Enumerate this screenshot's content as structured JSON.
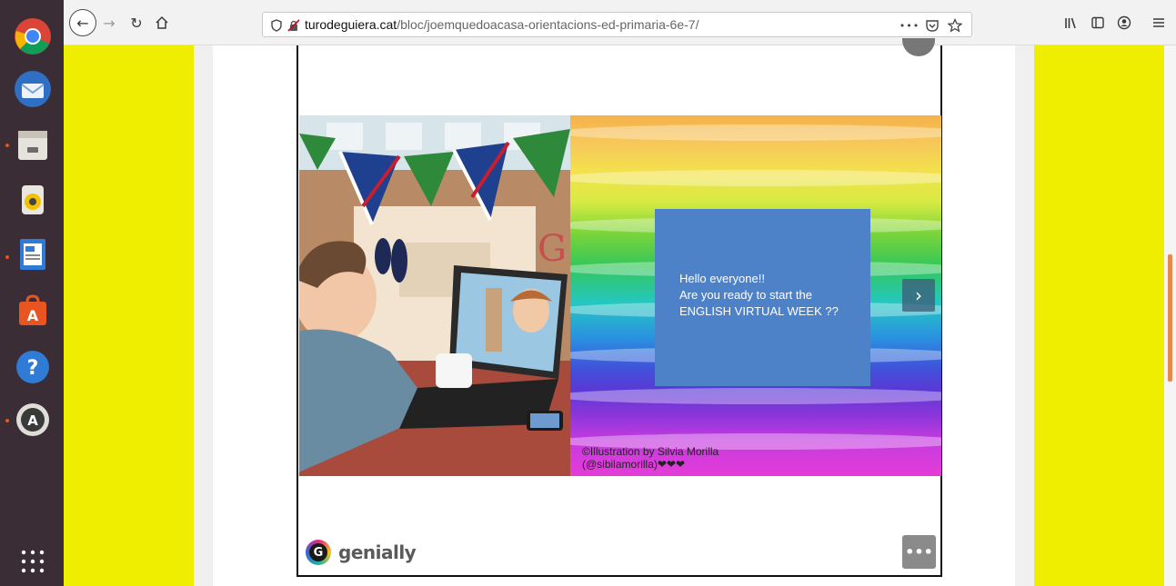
{
  "dock": {
    "items": [
      {
        "name": "Chrome",
        "icon": "chrome-icon"
      },
      {
        "name": "Thunderbird",
        "icon": "thunderbird-icon"
      },
      {
        "name": "Files",
        "icon": "files-icon"
      },
      {
        "name": "Rhythmbox",
        "icon": "rhythmbox-icon"
      },
      {
        "name": "LibreOffice Writer",
        "icon": "writer-icon"
      },
      {
        "name": "Ubuntu Software",
        "icon": "software-icon"
      },
      {
        "name": "Help",
        "icon": "help-icon"
      },
      {
        "name": "Software Updater",
        "icon": "updater-icon"
      }
    ],
    "accent": "#e95420"
  },
  "browser": {
    "url_domain": "turodeguiera.cat",
    "url_path": "/bloc/joemquedoacasa-orientacions-ed-primaria-6e-7/",
    "more_label": "•••"
  },
  "embed": {
    "card_text": "Hello everyone!!\nAre you ready to start the\nENGLISH VIRTUAL WEEK ??",
    "credit": "©Illustration by Silvia Morilla\n(@sibilamorilla)❤❤❤",
    "brand": "genially",
    "brand_letter": "G",
    "next_glyph": "›",
    "more_glyph": "•••",
    "card_color": "#4d82c9"
  },
  "page": {
    "side_color": "#f0ee00"
  }
}
